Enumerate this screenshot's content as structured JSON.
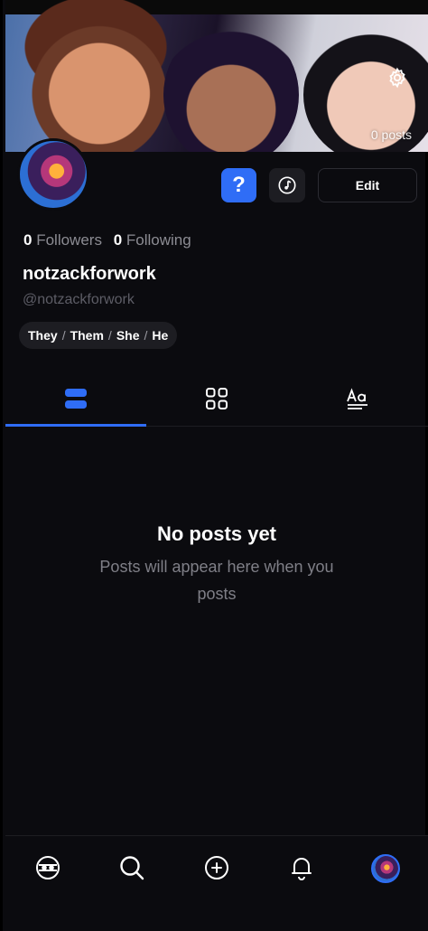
{
  "banner": {
    "posts_count": "0 posts"
  },
  "profile": {
    "followers_count": "0",
    "followers_label": "Followers",
    "following_count": "0",
    "following_label": "Following",
    "display_name": "notzackforwork",
    "handle": "@notzackforwork",
    "pronouns": [
      "They",
      "Them",
      "She",
      "He"
    ],
    "pronoun_separator": "/"
  },
  "actions": {
    "help_label": "?",
    "edit_label": "Edit"
  },
  "tabs": [
    {
      "icon": "list-view-icon",
      "active": true
    },
    {
      "icon": "grid-view-icon",
      "active": false
    },
    {
      "icon": "text-posts-icon",
      "active": false
    }
  ],
  "empty_state": {
    "title": "No posts yet",
    "subtitle": "Posts will appear here when you posts"
  },
  "bottom_nav": [
    "home-icon",
    "search-icon",
    "create-post-icon",
    "notifications-icon",
    "profile-avatar"
  ],
  "colors": {
    "accent": "#2f6df6",
    "background": "#0b0b0f",
    "muted": "#7f7f87"
  }
}
